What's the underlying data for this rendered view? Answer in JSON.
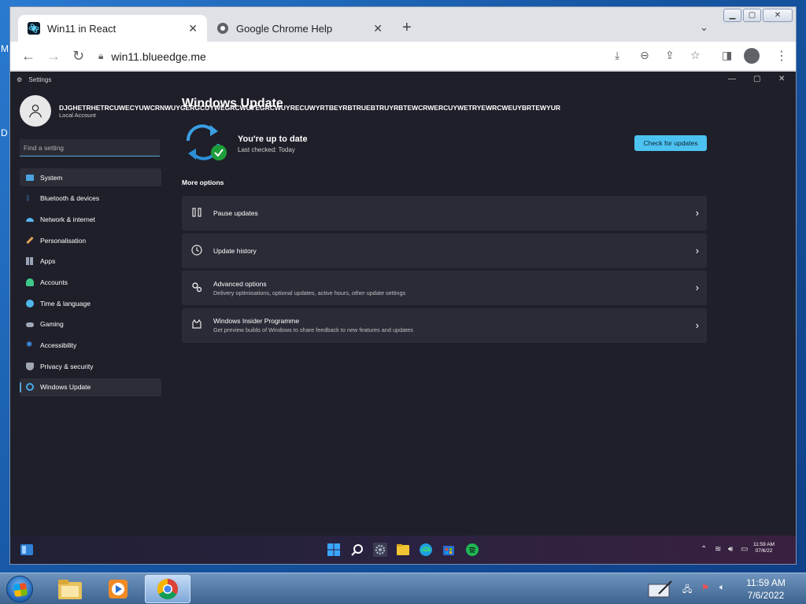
{
  "desktop": {
    "edge_letters": [
      "M",
      "D"
    ]
  },
  "browser": {
    "tabs": [
      {
        "title": "Win11 in React",
        "icon": "react-app-icon",
        "active": true
      },
      {
        "title": "Google Chrome Help",
        "icon": "chrome-help-icon",
        "active": false
      }
    ],
    "url": "win11.blueedge.me"
  },
  "settings": {
    "window_title": "Settings",
    "user": {
      "name": "DJGHETRHETRCUWECYUWCRNWUYGERGCUYWEGRCWUYEGRCWUYRECUWYRTBEYRBTRUEBTRUYRBTEWCRWERCUYWETRYEWRCWEUYBRTEWYUR",
      "account_type": "Local Account"
    },
    "search_placeholder": "Find a setting",
    "nav": [
      {
        "label": "System",
        "icon": "monitor-icon",
        "color": "#4aa3e0"
      },
      {
        "label": "Bluetooth & devices",
        "icon": "bluetooth-icon",
        "color": "#3f8fdc"
      },
      {
        "label": "Network & internet",
        "icon": "wifi-icon",
        "color": "#58b6f0"
      },
      {
        "label": "Personalisation",
        "icon": "brush-icon",
        "color": "#e0a25a"
      },
      {
        "label": "Apps",
        "icon": "apps-icon",
        "color": "#9aa4b8"
      },
      {
        "label": "Accounts",
        "icon": "person-icon",
        "color": "#3cc98a"
      },
      {
        "label": "Time & language",
        "icon": "globe-clock-icon",
        "color": "#4fb7e8"
      },
      {
        "label": "Gaming",
        "icon": "gamepad-icon",
        "color": "#a0a8b8"
      },
      {
        "label": "Accessibility",
        "icon": "accessibility-icon",
        "color": "#3d8fe0"
      },
      {
        "label": "Privacy & security",
        "icon": "shield-icon",
        "color": "#a0a6b2"
      },
      {
        "label": "Windows Update",
        "icon": "sync-icon",
        "color": "#45a9e6"
      }
    ],
    "page_title": "Windows Update",
    "status": {
      "title": "You're up to date",
      "subtitle": "Last checked: Today"
    },
    "check_button": "Check for updates",
    "more_options_label": "More options",
    "options": [
      {
        "title": "Pause updates",
        "subtitle": "",
        "icon": "pause-icon"
      },
      {
        "title": "Update history",
        "subtitle": "",
        "icon": "history-icon"
      },
      {
        "title": "Advanced options",
        "subtitle": "Delivery optimisations, optional updates, active hours, other update settings",
        "icon": "gears-icon"
      },
      {
        "title": "Windows Insider Programme",
        "subtitle": "Get preview builds of Windows to share feedback to new features and updates",
        "icon": "insider-cat-icon"
      }
    ],
    "taskbar": {
      "time": "11:59 AM",
      "date": "07/6/22"
    }
  },
  "win7_taskbar": {
    "time": "11:59 AM",
    "date": "7/6/2022"
  }
}
